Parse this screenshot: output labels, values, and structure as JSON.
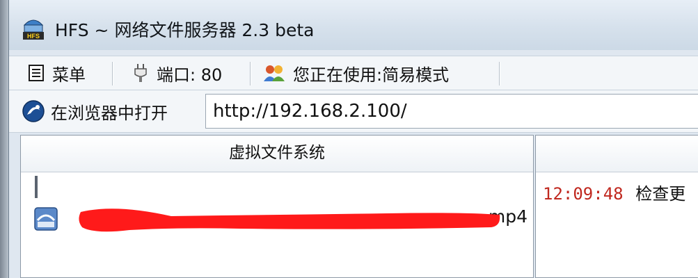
{
  "window": {
    "title": "HFS ~ 网络文件服务器 2.3 beta",
    "icon": "hfs-app-icon"
  },
  "toolbar": {
    "menu_label": "菜单",
    "port_label": "端口: 80",
    "mode_label": "您正在使用:简易模式"
  },
  "urlbar": {
    "open_label": "在浏览器中打开",
    "url": "http://192.168.2.100/"
  },
  "vfs": {
    "header": "虚拟文件系统",
    "file_name_visible": ".mp4",
    "redaction_color": "#ff1a1a"
  },
  "log": {
    "time": "12:09:48",
    "message": "检查更"
  },
  "colors": {
    "log_time": "#c0281f",
    "title_bg": "#dfe7f0"
  }
}
